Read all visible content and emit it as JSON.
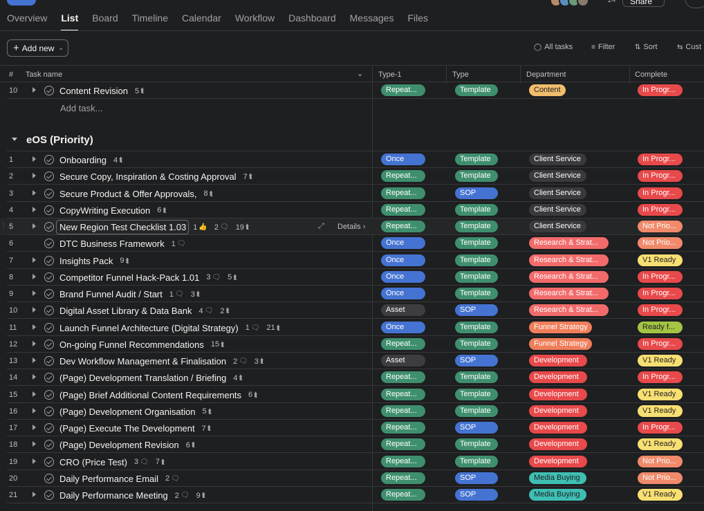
{
  "colors": {
    "repeat": "#3f8f6e",
    "once": "#4573d2",
    "asset": "#3d3d40",
    "template": "#3f8f6e",
    "sop": "#4573d2",
    "content": "#f1bd6c",
    "client_service": "#3a3a3d",
    "research": "#f26b6b",
    "funnel": "#f07e5a",
    "development": "#e8494a",
    "media": "#3fbfb3",
    "in_progress": "#e8494a",
    "not_priority": "#f08a6a",
    "v1_ready": "#f8df72",
    "ready_for": "#a4c443"
  },
  "topbar": {
    "tabs": [
      "Overview",
      "List",
      "Board",
      "Timeline",
      "Calendar",
      "Workflow",
      "Dashboard",
      "Messages",
      "Files"
    ],
    "active_tab": "List",
    "member_count": "14",
    "share_label": "Share"
  },
  "toolbar": {
    "add_new": "Add new",
    "all_tasks": "All tasks",
    "filter": "Filter",
    "sort": "Sort",
    "customize": "Cust"
  },
  "table": {
    "columns": {
      "num": "#",
      "task_name": "Task name",
      "type1": "Type-1",
      "type": "Type",
      "department": "Department",
      "complete": "Complete"
    },
    "add_task": "Add task...",
    "section_title": "eOS (Priority)",
    "details_label": "Details"
  },
  "top_row": {
    "num": "10",
    "name": "Content Revision",
    "subtasks": "5",
    "type1": "Repeat...",
    "type": "Template",
    "dept": "Content",
    "complete": "In Progr..."
  },
  "rows": [
    {
      "num": "1",
      "name": "Onboarding",
      "sub": "4",
      "type1": "Once",
      "type": "Template",
      "dept": "Client Service",
      "complete": "In Progr..."
    },
    {
      "num": "2",
      "name": "Secure Copy, Inspiration & Costing Approval",
      "sub": "7",
      "type1": "Repeat...",
      "type": "Template",
      "dept": "Client Service",
      "complete": "In Progr..."
    },
    {
      "num": "3",
      "name": "Secure Product & Offer Approvals,",
      "sub": "8",
      "type1": "Repeat...",
      "type": "SOP",
      "dept": "Client Service",
      "complete": "In Progr..."
    },
    {
      "num": "4",
      "name": "CopyWriting Execution",
      "sub": "6",
      "type1": "Repeat...",
      "type": "Template",
      "dept": "Client Service",
      "complete": "In Progr..."
    },
    {
      "num": "5",
      "name": "New Region Test Checklist 1.03",
      "likes": "1",
      "comments": "2",
      "sub": "19",
      "type1": "Repeat...",
      "type": "Template",
      "dept": "Client Service",
      "complete": "Not Prio..."
    },
    {
      "num": "6",
      "name": "DTC Business Framework",
      "comments": "1",
      "type1": "Once",
      "type": "Template",
      "dept": "Research & Strat...",
      "complete": "Not Prio..."
    },
    {
      "num": "7",
      "name": "Insights Pack",
      "sub": "9",
      "type1": "Once",
      "type": "Template",
      "dept": "Research & Strat...",
      "complete": "V1 Ready"
    },
    {
      "num": "8",
      "name": "Competitor Funnel Hack-Pack 1.01",
      "comments": "3",
      "sub": "5",
      "type1": "Once",
      "type": "Template",
      "dept": "Research & Strat...",
      "complete": "In Progr..."
    },
    {
      "num": "9",
      "name": "Brand Funnel Audit / Start",
      "comments": "1",
      "sub": "3",
      "type1": "Once",
      "type": "Template",
      "dept": "Research & Strat...",
      "complete": "In Progr..."
    },
    {
      "num": "10",
      "name": "Digital Asset Library & Data Bank",
      "comments": "4",
      "sub": "2",
      "type1": "Asset",
      "type": "SOP",
      "dept": "Research & Strat...",
      "complete": "In Progr..."
    },
    {
      "num": "11",
      "name": "Launch Funnel Architecture (Digital Strategy)",
      "comments": "1",
      "sub": "21",
      "type1": "Once",
      "type": "Template",
      "dept": "Funnel Strategy",
      "complete": "Ready f..."
    },
    {
      "num": "12",
      "name": "On-going Funnel Recommendations",
      "sub": "15",
      "type1": "Repeat...",
      "type": "Template",
      "dept": "Funnel Strategy",
      "complete": "In Progr..."
    },
    {
      "num": "13",
      "name": "Dev Workflow Management & Finalisation",
      "comments": "2",
      "sub": "3",
      "type1": "Asset",
      "type": "SOP",
      "dept": "Development",
      "complete": "V1 Ready"
    },
    {
      "num": "14",
      "name": "(Page) Development Translation / Briefing",
      "sub": "4",
      "type1": "Repeat...",
      "type": "Template",
      "dept": "Development",
      "complete": "In Progr..."
    },
    {
      "num": "15",
      "name": "(Page) Brief Additional Content Requirements",
      "sub": "6",
      "type1": "Repeat...",
      "type": "Template",
      "dept": "Development",
      "complete": "V1 Ready"
    },
    {
      "num": "16",
      "name": "(Page) Development Organisation",
      "sub": "5",
      "type1": "Repeat...",
      "type": "Template",
      "dept": "Development",
      "complete": "V1 Ready"
    },
    {
      "num": "17",
      "name": "(Page) Execute The Development",
      "sub": "7",
      "type1": "Repeat...",
      "type": "SOP",
      "dept": "Development",
      "complete": "In Progr..."
    },
    {
      "num": "18",
      "name": "(Page) Development Revision",
      "sub": "6",
      "type1": "Repeat...",
      "type": "Template",
      "dept": "Development",
      "complete": "V1 Ready"
    },
    {
      "num": "19",
      "name": "CRO (Price Test)",
      "comments": "3",
      "sub": "7",
      "type1": "Repeat...",
      "type": "Template",
      "dept": "Development",
      "complete": "Not Prio..."
    },
    {
      "num": "20",
      "name": "Daily Performance Email",
      "comments": "2",
      "type1": "Repeat...",
      "type": "SOP",
      "dept": "Media Buying",
      "complete": "Not Prio..."
    },
    {
      "num": "21",
      "name": "Daily Performance Meeting",
      "comments": "2",
      "sub": "9",
      "type1": "Repeat...",
      "type": "SOP",
      "dept": "Media Buying",
      "complete": "V1 Ready"
    }
  ]
}
